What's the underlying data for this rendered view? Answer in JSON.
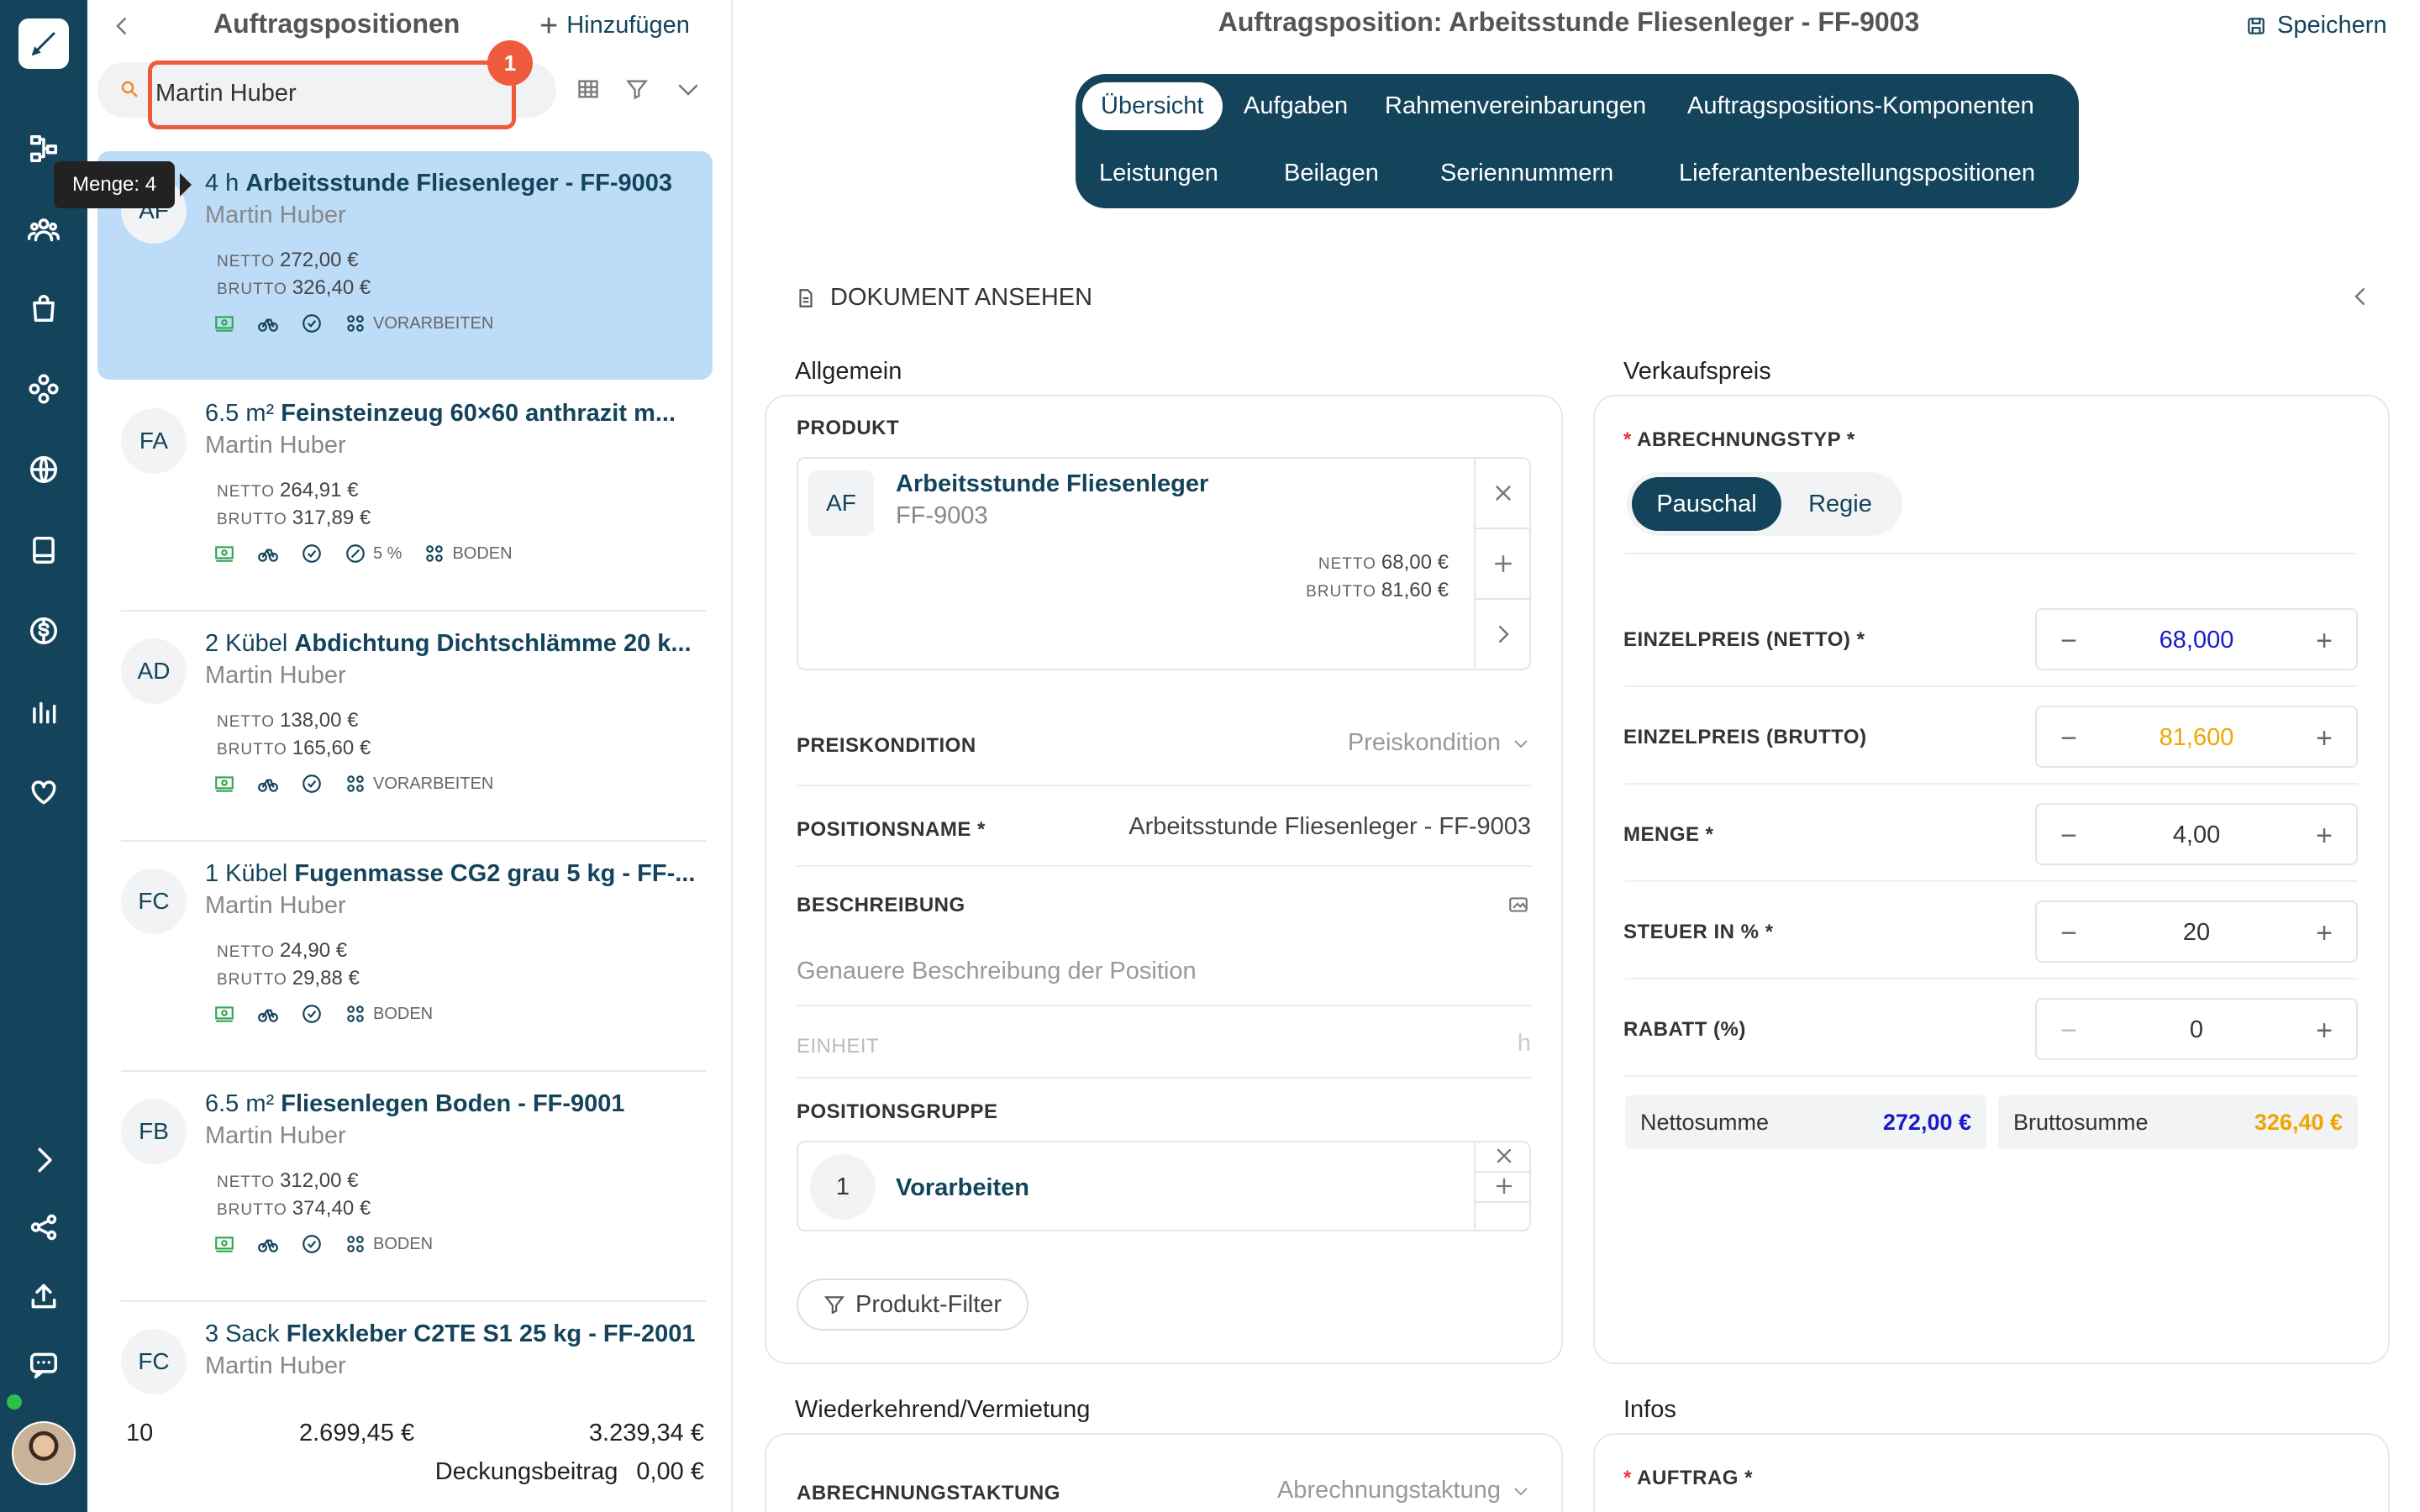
{
  "list": {
    "title": "Auftragspositionen",
    "add_label": "Hinzufügen",
    "search_value": "Martin Huber",
    "badge_count": "1",
    "tooltip": "Menge: 4",
    "items": [
      {
        "qty": "4 h",
        "name": "Arbeitsstunde Fliesenleger - FF-9003",
        "customer": "Martin Huber",
        "netto": "272,00 €",
        "brutto": "326,40 €",
        "avatar": "AF",
        "discount": "",
        "group": "VORARBEITEN"
      },
      {
        "qty": "6.5 m²",
        "name": "Feinsteinzeug 60×60 anthrazit m...",
        "customer": "Martin Huber",
        "netto": "264,91 €",
        "brutto": "317,89 €",
        "avatar": "FA",
        "discount": "5 %",
        "group": "BODEN"
      },
      {
        "qty": "2 Kübel",
        "name": "Abdichtung Dichtschlämme 20 k...",
        "customer": "Martin Huber",
        "netto": "138,00 €",
        "brutto": "165,60 €",
        "avatar": "AD",
        "discount": "",
        "group": "VORARBEITEN"
      },
      {
        "qty": "1 Kübel",
        "name": "Fugenmasse CG2 grau 5 kg - FF-...",
        "customer": "Martin Huber",
        "netto": "24,90 €",
        "brutto": "29,88 €",
        "avatar": "FC",
        "discount": "",
        "group": "BODEN"
      },
      {
        "qty": "6.5 m²",
        "name": "Fliesenlegen Boden - FF-9001",
        "customer": "Martin Huber",
        "netto": "312,00 €",
        "brutto": "374,40 €",
        "avatar": "FB",
        "discount": "",
        "group": "BODEN"
      },
      {
        "qty": "3 Sack",
        "name": "Flexkleber C2TE S1 25 kg - FF-2001",
        "customer": "Martin Huber",
        "avatar": "FC"
      }
    ],
    "price_labels": {
      "netto": "NETTO",
      "brutto": "BRUTTO"
    },
    "footer": {
      "count": "10",
      "netto_total": "2.699,45 €",
      "brutto_total": "3.239,34 €",
      "db_label": "Deckungsbeitrag",
      "db_value": "0,00 €"
    }
  },
  "header": {
    "title": "Auftragsposition: Arbeitsstunde Fliesenleger - FF-9003",
    "save_label": "Speichern"
  },
  "tabs": [
    "Übersicht",
    "Aufgaben",
    "Rahmenvereinbarungen",
    "Auftragspositions-Komponenten",
    "Leistungen",
    "Beilagen",
    "Seriennummern",
    "Lieferantenbestellungspositionen"
  ],
  "doc_link": "DOKUMENT ANSEHEN",
  "allgemein": {
    "title": "Allgemein",
    "produkt_label": "PRODUKT",
    "produkt": {
      "avatar": "AF",
      "name": "Arbeitsstunde Fliesenleger",
      "sku": "FF-9003",
      "netto": "68,00 €",
      "brutto": "81,60 €"
    },
    "preiskondition_label": "PREISKONDITION",
    "preiskondition_placeholder": "Preiskondition",
    "positionsname_label": "POSITIONSNAME *",
    "positionsname_value": "Arbeitsstunde Fliesenleger - FF-9003",
    "beschreibung_label": "BESCHREIBUNG",
    "beschreibung_placeholder": "Genauere Beschreibung der Position",
    "einheit_label": "EINHEIT",
    "einheit_value": "h",
    "positionsgruppe_label": "POSITIONSGRUPPE",
    "gruppe_nr": "1",
    "gruppe_name": "Vorarbeiten",
    "filter_button": "Produkt-Filter"
  },
  "verkaufspreis": {
    "title": "Verkaufspreis",
    "abrechnungstyp_label": "ABRECHNUNGSTYP *",
    "option_pauschal": "Pauschal",
    "option_regie": "Regie",
    "einzelpreis_netto_label": "EINZELPREIS (NETTO) *",
    "einzelpreis_netto": "68,000",
    "einzelpreis_brutto_label": "EINZELPREIS (BRUTTO)",
    "einzelpreis_brutto": "81,600",
    "menge_label": "MENGE *",
    "menge": "4,00",
    "steuer_label": "STEUER IN % *",
    "steuer": "20",
    "rabatt_label": "RABATT (%)",
    "rabatt": "0",
    "nettosumme_label": "Nettosumme",
    "nettosumme": "272,00 €",
    "bruttosumme_label": "Bruttosumme",
    "bruttosumme": "326,40 €"
  },
  "wiederkehrend": {
    "title": "Wiederkehrend/Vermietung",
    "abrechnungstaktung_label": "ABRECHNUNGSTAKTUNG",
    "abrechnungstaktung_placeholder": "Abrechnungstaktung"
  },
  "infos": {
    "title": "Infos",
    "auftrag_label": "AUFTRAG *"
  },
  "colors": {
    "primary": "#13445c",
    "selected": "#bcdcf8",
    "netto_blue": "#1a1acc",
    "brutto_orange": "#f0a500",
    "badge": "#ee5a3c"
  }
}
